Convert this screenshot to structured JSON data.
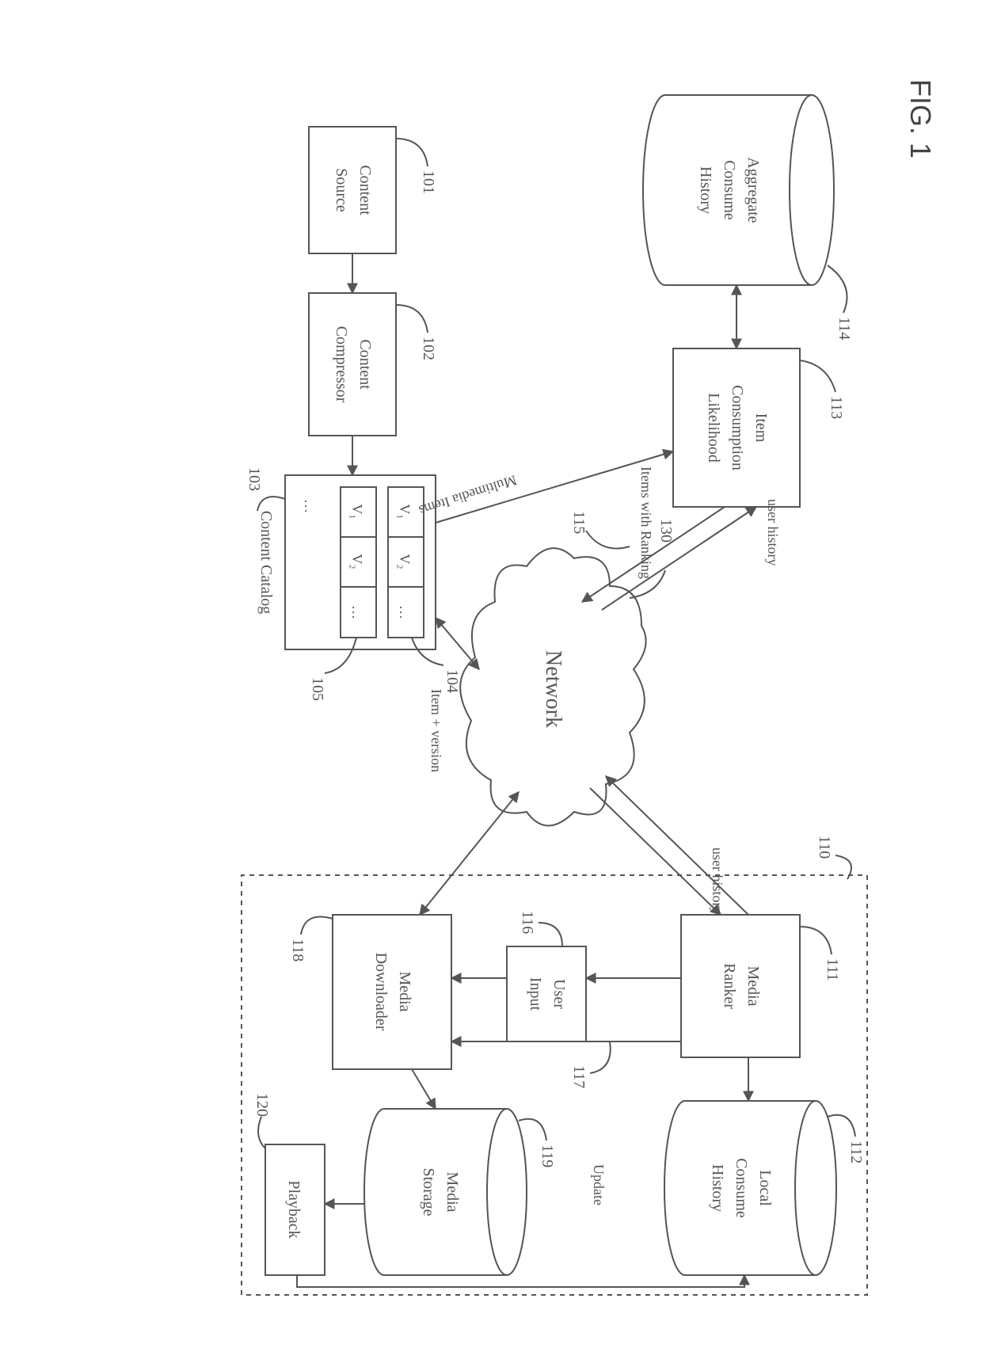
{
  "figure_label": "FIG. 1",
  "nodes": {
    "aggregate_consume_history": {
      "ref": "114",
      "label": [
        "Aggregate",
        "Consume",
        "History"
      ]
    },
    "item_consumption_likelihood": {
      "ref": "113",
      "label": [
        "Item",
        "Consumption",
        "Likelihood"
      ]
    },
    "content_source": {
      "ref": "101",
      "label": [
        "Content",
        "Source"
      ]
    },
    "content_compressor": {
      "ref": "102",
      "label": [
        "Content",
        "Compressor"
      ]
    },
    "content_catalog": {
      "ref": "103",
      "label": "Content Catalog",
      "rows": [
        {
          "ref": "104",
          "cells": [
            "V₁",
            "V₂",
            "…"
          ]
        },
        {
          "ref": "105",
          "cells": [
            "V₁",
            "V₂",
            "…"
          ]
        }
      ],
      "ellipsis": "…"
    },
    "network": {
      "ref": "130",
      "label": "Network"
    },
    "client_device": {
      "ref": "110"
    },
    "media_ranker": {
      "ref": "111",
      "label": [
        "Media",
        "Ranker"
      ]
    },
    "local_consume_history": {
      "ref": "112",
      "label": [
        "Local",
        "Consume",
        "History"
      ]
    },
    "user_input": {
      "ref": "116",
      "label": [
        "User",
        "Input"
      ]
    },
    "media_downloader": {
      "ref": "118",
      "label": [
        "Media",
        "Downloader"
      ]
    },
    "media_storage": {
      "ref": "119",
      "label": [
        "Media",
        "Storage"
      ]
    },
    "playback": {
      "ref": "120",
      "label": "Playback"
    }
  },
  "edges": {
    "user_history_left": "user history",
    "items_with_ranking": {
      "ref": "115",
      "label": "Items with Ranking"
    },
    "multimedia_items": "Multimedia Items",
    "item_version": "Item + version",
    "user_history_right": "user history",
    "ranker_to_downloader": {
      "ref": "117"
    },
    "update": "Update"
  }
}
